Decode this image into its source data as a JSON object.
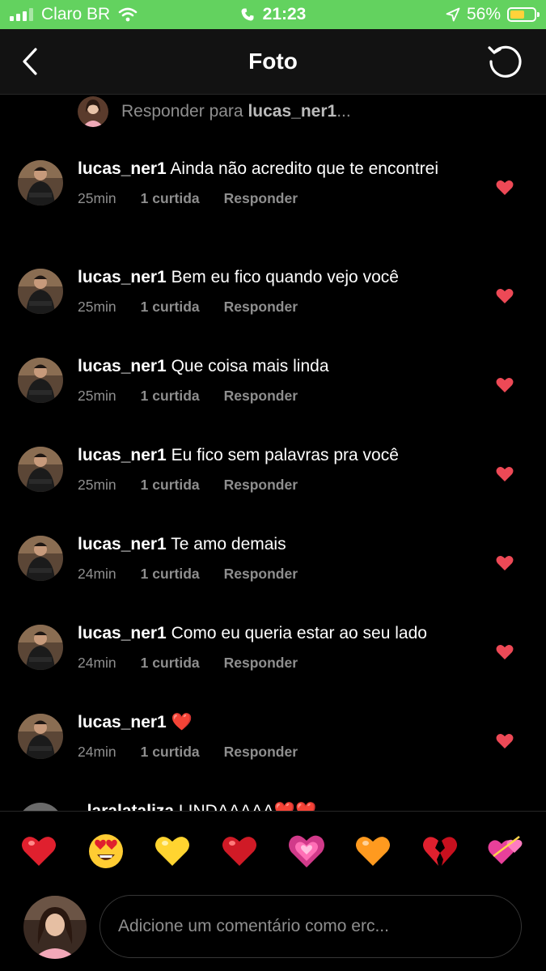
{
  "status_bar": {
    "carrier": "Claro BR",
    "time": "21:23",
    "battery_percent": "56%",
    "battery_level": 0.56,
    "icons": [
      "signal-icon",
      "wifi-icon",
      "phone-icon",
      "location-arrow-icon",
      "battery-icon"
    ]
  },
  "header": {
    "title": "Foto",
    "back_icon": "chevron-left-icon",
    "refresh_icon": "refresh-icon"
  },
  "reply_banner": {
    "prefix": "Responder para ",
    "username": "lucas_ner1",
    "ellipsis": "..."
  },
  "comments": [
    {
      "user": "lucas_ner1",
      "text": "Ainda não acredito que te encontrei",
      "time": "25min",
      "likes": "1 curtida",
      "reply": "Responder"
    },
    {
      "user": "lucas_ner1",
      "text": "Bem eu fico quando vejo você",
      "time": "25min",
      "likes": "1 curtida",
      "reply": "Responder"
    },
    {
      "user": "lucas_ner1",
      "text": "Que coisa mais linda",
      "time": "25min",
      "likes": "1 curtida",
      "reply": "Responder"
    },
    {
      "user": "lucas_ner1",
      "text": "Eu fico sem palavras pra você",
      "time": "25min",
      "likes": "1 curtida",
      "reply": "Responder"
    },
    {
      "user": "lucas_ner1",
      "text": "Te amo demais",
      "time": "24min",
      "likes": "1 curtida",
      "reply": "Responder"
    },
    {
      "user": "lucas_ner1",
      "text": "Como eu queria estar ao seu lado",
      "time": "24min",
      "likes": "1 curtida",
      "reply": "Responder"
    },
    {
      "user": "lucas_ner1",
      "text": "❤️",
      "time": "24min",
      "likes": "1 curtida",
      "reply": "Responder"
    },
    {
      "user": "_laralataliza",
      "text": "LINDAAAAA❤️❤️",
      "time": "",
      "likes": "",
      "reply": ""
    }
  ],
  "quick_emojis": [
    "red-heart",
    "heart-eyes",
    "yellow-heart",
    "red-heart-dark",
    "growing-heart",
    "orange-heart",
    "broken-heart",
    "two-hearts"
  ],
  "composer": {
    "placeholder": "Adicione um comentário como erc..."
  },
  "colors": {
    "status_bar_bg": "#63d25f",
    "background": "#000000",
    "header_bg": "#121212",
    "like_heart": "#ed4956",
    "secondary_text": "#8e8e8e"
  }
}
